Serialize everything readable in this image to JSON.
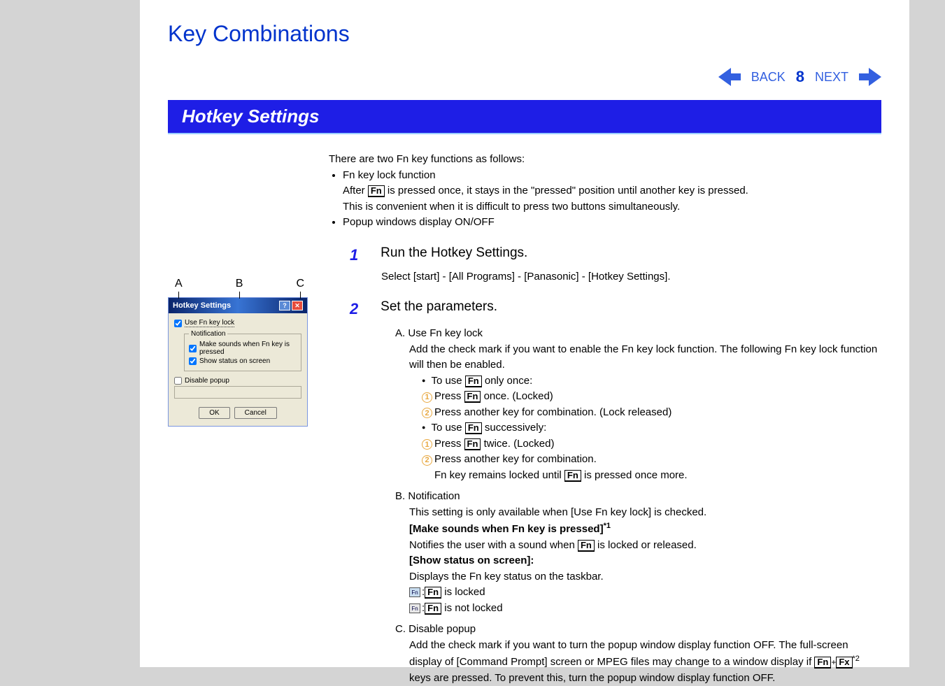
{
  "title": "Key Combinations",
  "nav": {
    "back": "BACK",
    "next": "NEXT",
    "page": "8"
  },
  "section_header": "Hotkey Settings",
  "intro": "There are two Fn key functions as follows:",
  "bullets": {
    "fn_lock": "Fn key lock function",
    "fn_lock_desc1a": "After ",
    "fn_lock_desc1b": " is pressed once, it stays in the \"pressed\" position until another key is pressed.",
    "fn_lock_desc2": "This is convenient when it is difficult to press two buttons simultaneously.",
    "popup": "Popup windows display ON/OFF"
  },
  "step1": {
    "num": "1",
    "title": "Run the Hotkey Settings.",
    "detail": "Select [start] - [All Programs] - [Panasonic] - [Hotkey Settings]."
  },
  "step2": {
    "num": "2",
    "title": "Set the parameters.",
    "a": {
      "label": "A.",
      "title": "Use Fn key lock",
      "desc": "Add the check mark if you want to enable the Fn key lock function. The following Fn key lock function will then be enabled.",
      "once_pre": "To use ",
      "once_post": " only once:",
      "once_1a": "Press ",
      "once_1b": " once. (Locked)",
      "once_2": "Press another key for combination. (Lock released)",
      "succ_pre": "To use ",
      "succ_post": " successively:",
      "succ_1a": "Press ",
      "succ_1b": " twice. (Locked)",
      "succ_2": "Press another key for combination.",
      "succ_2b_pre": "Fn key remains locked until ",
      "succ_2b_post": " is pressed once more."
    },
    "b": {
      "label": "B.",
      "title": "Notification",
      "desc": "This setting is only available when [Use Fn key lock] is checked.",
      "make_sounds": "[Make sounds when Fn key is pressed]",
      "make_sounds_sup": "*1",
      "make_sounds_desc_pre": "Notifies the user with a sound when ",
      "make_sounds_desc_post": " is locked or released.",
      "show_status": "[Show status on screen]:",
      "show_status_desc": "Displays the Fn key status on the taskbar.",
      "locked": " is locked",
      "not_locked": " is not locked"
    },
    "c": {
      "label": "C.",
      "title": "Disable popup",
      "desc1": "Add the check mark if you want to turn the popup window display function OFF. The full-screen display of [Command Prompt] screen or MPEG files may change to a window display if ",
      "desc_sup": "*2",
      "desc2": " keys are pressed.   To prevent this, turn the popup window display function OFF."
    }
  },
  "labels": {
    "a": "A",
    "b": "B",
    "c": "C"
  },
  "dialog": {
    "title": "Hotkey Settings",
    "use_fn": "Use Fn key lock",
    "notif_legend": "Notification",
    "make_sounds": "Make sounds when Fn key is pressed",
    "show_status": "Show status on screen",
    "disable_popup": "Disable popup",
    "ok": "OK",
    "cancel": "Cancel"
  },
  "fn": "Fn",
  "fx": "Fx"
}
